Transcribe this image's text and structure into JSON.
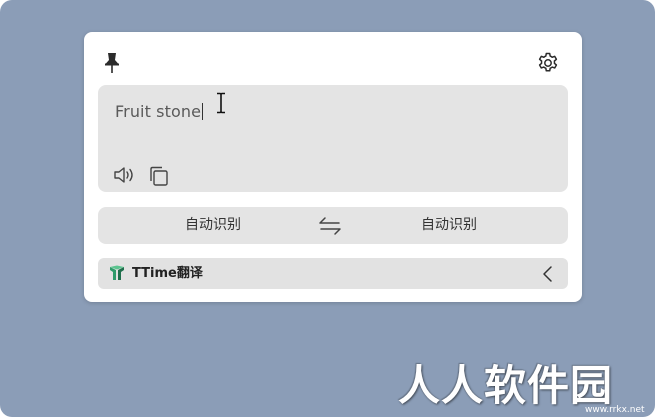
{
  "colors": {
    "desktop_background": "#8b9db7",
    "card_background": "#ffffff",
    "panel_background": "#e4e4e4",
    "logo_green": "#2e9b6a"
  },
  "toolbar": {
    "pin_icon": "pin-icon",
    "settings_icon": "gear-icon"
  },
  "input": {
    "text": "Fruit stone",
    "speak_icon": "speaker-icon",
    "copy_icon": "copy-icon"
  },
  "languages": {
    "source": "自动识别",
    "target": "自动识别",
    "swap_icon": "swap-arrows-icon"
  },
  "engine": {
    "name": "TTime翻译",
    "logo_icon": "ttime-logo-icon",
    "collapse_icon": "chevron-left-icon"
  },
  "watermark": {
    "text": "人人软件园",
    "url": "www.rrkx.net"
  }
}
